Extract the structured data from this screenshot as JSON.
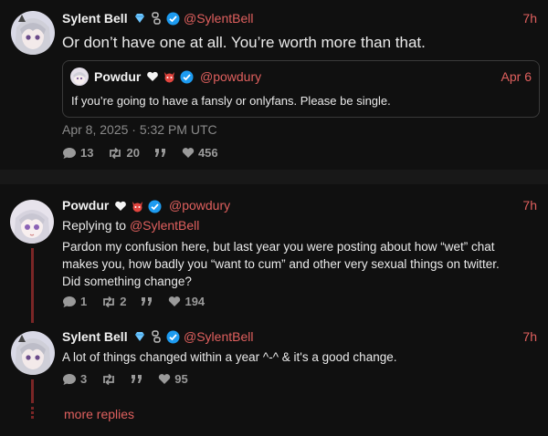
{
  "post": {
    "author": "Sylent Bell",
    "handle": "@SylentBell",
    "time": "7h",
    "text": "Or don’t have one at all. You’re worth more than that.",
    "quote": {
      "author": "Powdur",
      "handle": "@powdury",
      "date": "Apr 6",
      "text": "If you’re going to have a fansly or onlyfans. Please be single."
    },
    "timestamp": "Apr 8, 2025 · 5:32 PM UTC",
    "stats": {
      "replies": "13",
      "retweets": "20",
      "likes": "456"
    }
  },
  "reply1": {
    "author": "Powdur",
    "handle": "@powdury",
    "time": "7h",
    "replying_prefix": "Replying to ",
    "replying_to": "@SylentBell",
    "text": "Pardon my confusion here, but last year you were posting about how “wet” chat makes you, how badly you “want to cum” and other very sexual things on twitter. Did something change?",
    "stats": {
      "replies": "1",
      "retweets": "2",
      "likes": "194"
    }
  },
  "reply2": {
    "author": "Sylent Bell",
    "handle": "@SylentBell",
    "time": "7h",
    "text": "A lot of things changed within a year ^-^ & it's a good change.",
    "stats": {
      "replies": "3",
      "likes": "95"
    }
  },
  "more_replies": "more replies",
  "colors": {
    "accent": "#e0605e",
    "verified": "#1d9bf0",
    "background": "#101010"
  }
}
